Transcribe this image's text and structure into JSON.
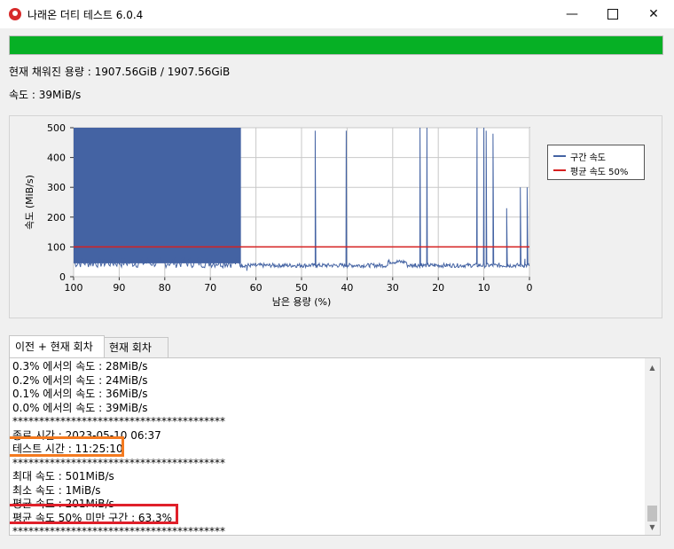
{
  "window": {
    "title": "나래온 더티 테스트 6.0.4",
    "min_symbol": "—",
    "close_symbol": "✕"
  },
  "progress": {
    "fraction": 1.0,
    "color": "#06b025"
  },
  "status": {
    "written_label": "현재 채워진 용량 : 1907.56GiB / 1907.56GiB",
    "speed_label": "속도 : 39MiB/s"
  },
  "chart_data": {
    "type": "line",
    "ylabel": "속도 (MiB/s)",
    "xlabel": "남은 용량 (%)",
    "x_reversed": true,
    "xlim": [
      100,
      0
    ],
    "ylim": [
      0,
      500
    ],
    "x_ticks": [
      100,
      90,
      80,
      70,
      60,
      50,
      40,
      30,
      20,
      10,
      0
    ],
    "y_ticks": [
      0,
      100,
      200,
      300,
      400,
      500
    ],
    "grid": true,
    "legend_position": "right",
    "series": [
      {
        "name": "구간 속도",
        "color": "#4463a3",
        "segments": [
          {
            "x_range": [
              100,
              63.3
            ],
            "note_values": [
              500,
              45
            ]
          },
          {
            "x_range": [
              63.3,
              0
            ],
            "typical": 40
          }
        ],
        "points": [
          [
            100,
            45
          ],
          [
            99,
            500
          ],
          [
            95,
            45
          ],
          [
            90,
            500
          ],
          [
            85,
            45
          ],
          [
            80,
            500
          ],
          [
            75,
            45
          ],
          [
            70,
            500
          ],
          [
            64,
            500
          ],
          [
            63.5,
            70
          ],
          [
            63,
            40
          ],
          [
            62,
            20
          ],
          [
            60,
            35
          ],
          [
            55,
            38
          ],
          [
            50,
            40
          ],
          [
            47.3,
            40
          ],
          [
            47,
            490
          ],
          [
            46.7,
            40
          ],
          [
            45,
            42
          ],
          [
            40.5,
            40
          ],
          [
            40.2,
            490
          ],
          [
            40,
            40
          ],
          [
            35,
            40
          ],
          [
            31,
            55
          ],
          [
            30,
            48
          ],
          [
            25,
            45
          ],
          [
            24,
            500
          ],
          [
            23.7,
            45
          ],
          [
            22.5,
            500
          ],
          [
            22,
            40
          ],
          [
            18,
            40
          ],
          [
            12,
            40
          ],
          [
            11.5,
            500
          ],
          [
            11,
            40
          ],
          [
            10,
            500
          ],
          [
            9.5,
            490
          ],
          [
            9,
            40
          ],
          [
            8,
            480
          ],
          [
            7.6,
            40
          ],
          [
            5,
            230
          ],
          [
            4.7,
            40
          ],
          [
            2,
            300
          ],
          [
            1.7,
            40
          ],
          [
            1,
            60
          ],
          [
            0.5,
            300
          ],
          [
            0,
            40
          ]
        ]
      },
      {
        "name": "평균 속도 50%",
        "color": "#d62020",
        "values": [
          100,
          100
        ]
      }
    ]
  },
  "tabs": [
    {
      "label": "이전 + 현재 회차",
      "active": true
    },
    {
      "label": "현재 회차",
      "active": false
    }
  ],
  "log": {
    "lines": [
      "0.3% 에서의 속도 : 28MiB/s",
      "0.2% 에서의 속도 : 24MiB/s",
      "0.1% 에서의 속도 : 36MiB/s",
      "0.0% 에서의 속도 : 39MiB/s",
      "****************************************",
      "종료 시간 : 2023-05-10 06:37",
      "테스트 시간 : 11:25:10",
      "****************************************",
      "최대 속도 : 501MiB/s",
      "최소 속도 : 1MiB/s",
      "평균 속도 : 201MiB/s",
      "평균 속도 50% 미만 구간 : 63.3%",
      "****************************************"
    ],
    "highlight_colors": {
      "test_time": "#f47a1f",
      "below_half": "#e0202a"
    }
  }
}
